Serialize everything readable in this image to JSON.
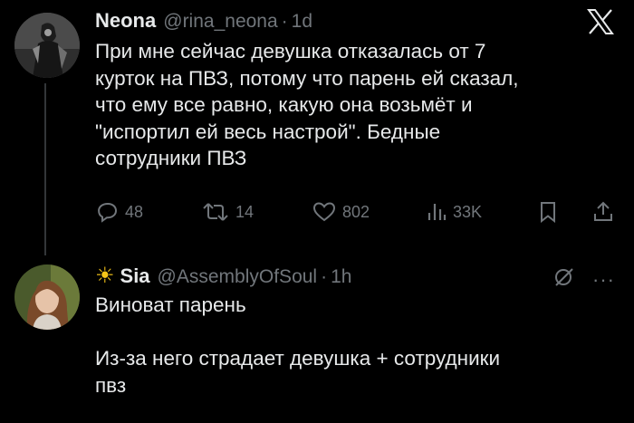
{
  "post": {
    "author_name": "Neona",
    "author_handle": "@rina_neona",
    "separator": "·",
    "time": "1d",
    "text": "При мне сейчас девушка отказалась от 7\nкурток на ПВЗ, потому что парень ей сказал,\nчто ему все равно, какую она возьмёт и\n\"испортил ей весь настрой\". Бедные\nсотрудники ПВЗ",
    "stats": {
      "replies": "48",
      "reposts": "14",
      "likes": "802",
      "views": "33K"
    }
  },
  "reply": {
    "author_emoji": "☀",
    "author_name": "Sia",
    "author_handle": "@AssemblyOfSoul",
    "separator": "·",
    "time": "1h",
    "text": "Виноват парень\n\nИз-за него страдает девушка + сотрудники\nпвз"
  },
  "icons": {
    "brand": "x-logo",
    "reply": "reply-icon",
    "repost": "repost-icon",
    "like": "heart-icon",
    "views": "views-icon",
    "bookmark": "bookmark-icon",
    "share": "share-icon",
    "grok": "grok-icon",
    "more": "more-icon"
  },
  "colors": {
    "background": "#000000",
    "text": "#e7e9ea",
    "muted": "#71767b",
    "sun": "#f5c518"
  }
}
